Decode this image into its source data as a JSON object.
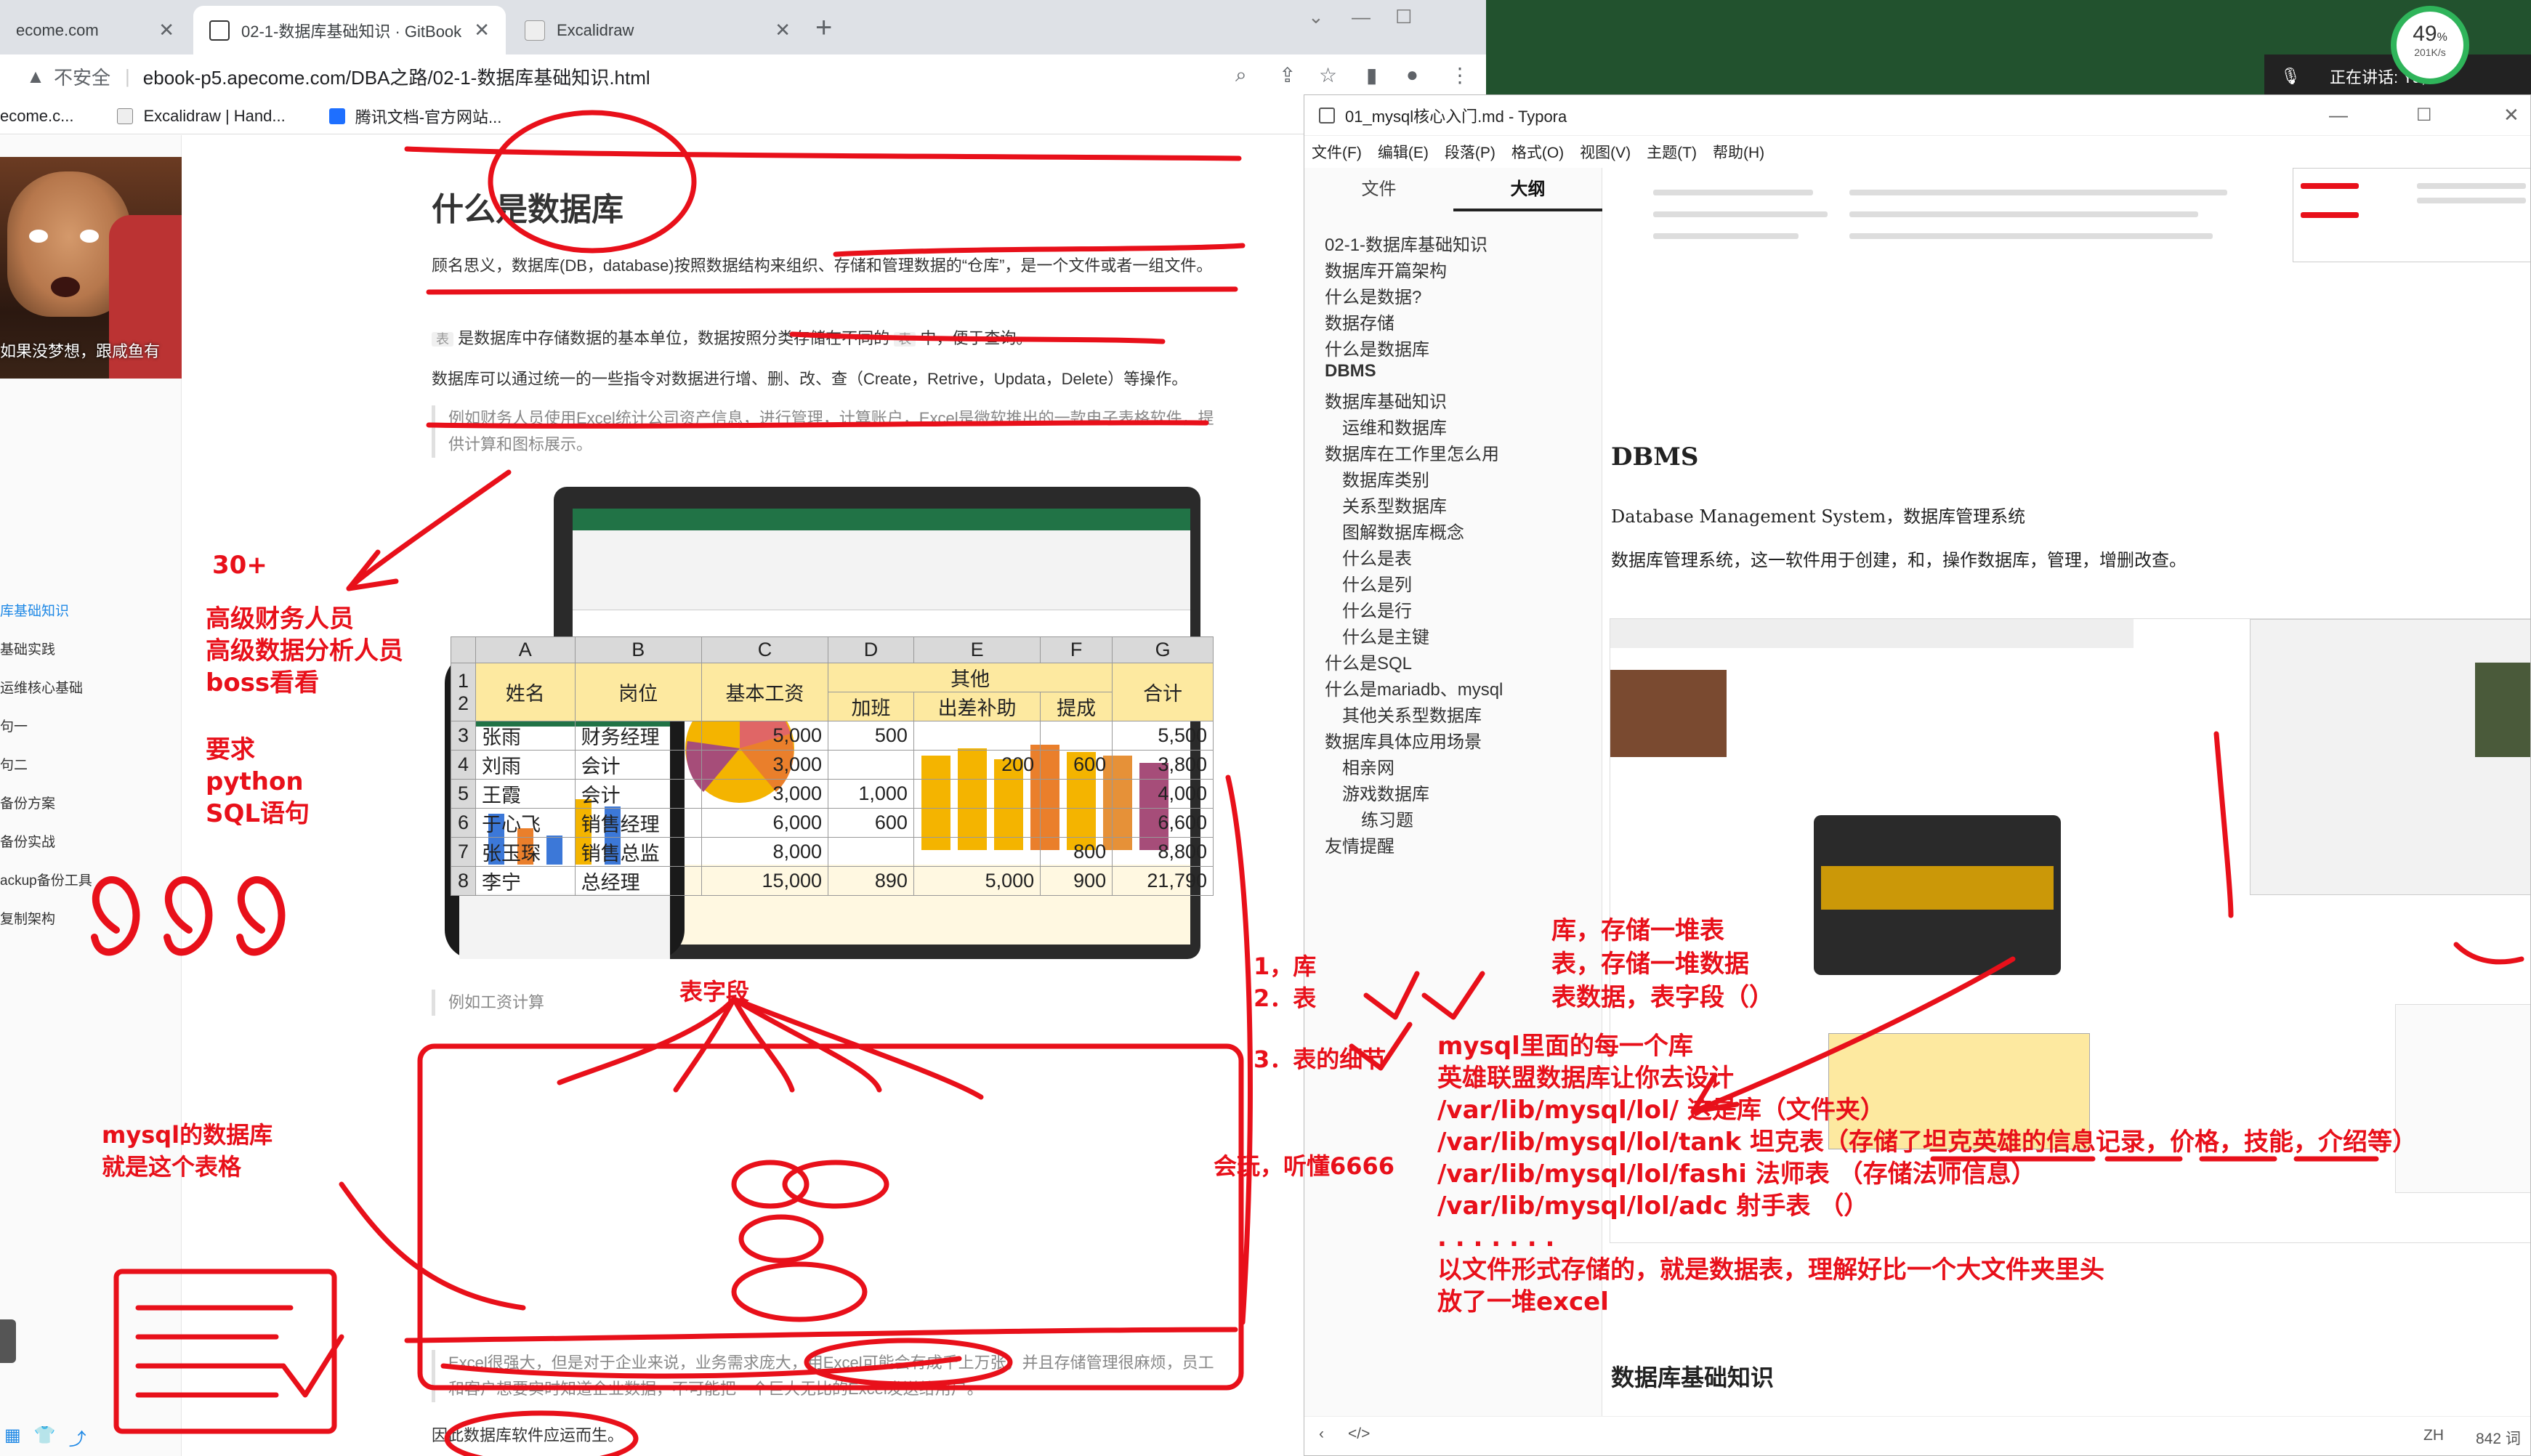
{
  "chrome": {
    "tabs": [
      {
        "label": "ecome.com"
      },
      {
        "label": "02-1-数据库基础知识 · GitBook"
      },
      {
        "label": "Excalidraw"
      }
    ],
    "new_tab": "+",
    "address": {
      "insecure": "不安全",
      "url": "ebook-p5.apecome.com/DBA之路/02-1-数据库基础知识.html"
    },
    "bookmarks": [
      "ecome.c...",
      "Excalidraw | Hand...",
      "腾讯文档-官方网站..."
    ]
  },
  "meeting": {
    "label": "正在讲话: Yu;"
  },
  "perf": {
    "percent": "49",
    "unit": "%",
    "speed": "201K/s"
  },
  "leftnav": {
    "video_caption": "如果没梦想，跟咸鱼有",
    "items": [
      "库基础知识",
      "基础实践",
      "运维核心基础",
      "句一",
      "句二",
      "备份方案",
      "备份实战",
      "ackup备份工具",
      "复制架构"
    ]
  },
  "article": {
    "title": "什么是数据库",
    "p1": "顾名思义，数据库(DB，database)按照数据结构来组织、存储和管理数据的“仓库”，是一个文件或者一组文件。",
    "p2_code": "表",
    "p2": "是数据库中存储数据的基本单位，数据按照分类存储在不同的",
    "p2_code2": "表",
    "p2_end": "中，便于查询。",
    "p3": "数据库可以通过统一的一些指令对数据进行增、删、改、查（Create，Retrive，Updata，Delete）等操作。",
    "q1": "例如财务人员使用Excel统计公司资产信息，进行管理，计算账户，Excel是微软推出的一款电子表格软件，提供计算和图标展示。",
    "q2": "例如工资计算",
    "q3": "Excel很强大，但是对于企业来说，业务需求庞大，用Excel可能会有成千上万张，并且存储管理很麻烦，员工和客户想要实时知道企业数据，不可能把一个巨大无比的Excel发送给用户。",
    "p4": "因此数据库软件应运而生。"
  },
  "spreadsheet": {
    "cols": [
      "A",
      "B",
      "C",
      "D",
      "E",
      "F",
      "G"
    ],
    "header1": [
      "姓名",
      "岗位",
      "基本工资",
      "其他",
      "合计"
    ],
    "header2": [
      "加班",
      "出差补助",
      "提成"
    ],
    "rows": [
      {
        "n": "3",
        "name": "张雨",
        "job": "财务经理",
        "base": "5,000",
        "ot": "500",
        "trip": "",
        "comm": "",
        "total": "5,500"
      },
      {
        "n": "4",
        "name": "刘雨",
        "job": "会计",
        "base": "3,000",
        "ot": "",
        "trip": "200",
        "comm": "600",
        "total": "3,800"
      },
      {
        "n": "5",
        "name": "王霞",
        "job": "会计",
        "base": "3,000",
        "ot": "1,000",
        "trip": "",
        "comm": "",
        "total": "4,000"
      },
      {
        "n": "6",
        "name": "于心飞",
        "job": "销售经理",
        "base": "6,000",
        "ot": "600",
        "trip": "",
        "comm": "",
        "total": "6,600"
      },
      {
        "n": "7",
        "name": "张玉琛",
        "job": "销售总监",
        "base": "8,000",
        "ot": "",
        "trip": "",
        "comm": "800",
        "total": "8,800"
      },
      {
        "n": "8",
        "name": "李宁",
        "job": "总经理",
        "base": "15,000",
        "ot": "890",
        "trip": "5,000",
        "comm": "900",
        "total": "21,790"
      }
    ]
  },
  "typora": {
    "title": "01_mysql核心入门.md - Typora",
    "menu": [
      "文件(F)",
      "编辑(E)",
      "段落(P)",
      "格式(O)",
      "视图(V)",
      "主题(T)",
      "帮助(H)"
    ],
    "side_tabs": [
      "文件",
      "大纲"
    ],
    "outline": [
      {
        "t": "02-1-数据库基础知识",
        "lvl": 0
      },
      {
        "t": "数据库开篇架构",
        "lvl": 0
      },
      {
        "t": "什么是数据?",
        "lvl": 0
      },
      {
        "t": "数据存储",
        "lvl": 0
      },
      {
        "t": "什么是数据库",
        "lvl": 0
      },
      {
        "t": "DBMS",
        "lvl": 0
      },
      {
        "t": "数据库基础知识",
        "lvl": 0
      },
      {
        "t": "运维和数据库",
        "lvl": 1
      },
      {
        "t": "数据库在工作里怎么用",
        "lvl": 0
      },
      {
        "t": "数据库类别",
        "lvl": 1
      },
      {
        "t": "关系型数据库",
        "lvl": 1
      },
      {
        "t": "图解数据库概念",
        "lvl": 1
      },
      {
        "t": "什么是表",
        "lvl": 1
      },
      {
        "t": "什么是列",
        "lvl": 1
      },
      {
        "t": "什么是行",
        "lvl": 1
      },
      {
        "t": "什么是主键",
        "lvl": 1
      },
      {
        "t": "什么是SQL",
        "lvl": 0
      },
      {
        "t": "什么是mariadb、mysql",
        "lvl": 0
      },
      {
        "t": "其他关系型数据库",
        "lvl": 1
      },
      {
        "t": "数据库具体应用场景",
        "lvl": 0
      },
      {
        "t": "相亲网",
        "lvl": 1
      },
      {
        "t": "游戏数据库",
        "lvl": 1
      },
      {
        "t": "练习题",
        "lvl": 2
      },
      {
        "t": "友情提醒",
        "lvl": 0
      }
    ],
    "h_dbms": "DBMS",
    "p_dbms1": "Database Management System，数据库管理系统",
    "p_dbms2": "数据库管理系统，这一软件用于创建，和，操作数据库，管理，增删改查。",
    "h_basic": "数据库基础知识",
    "status_lang": "ZH",
    "status_words": "842 词"
  },
  "annotations": {
    "n30": "30+",
    "finance": [
      "高级财务人员",
      "高级数据分析人员",
      "boss看看"
    ],
    "require": [
      "要求",
      "python",
      "SQL语句"
    ],
    "n666": "666",
    "mysql_db": [
      "mysql的数据库",
      "就是这个表格"
    ],
    "field": "表字段",
    "lib": [
      "1，库",
      "2．表",
      "3．表的细节"
    ],
    "play": "会玩，听懂6666",
    "store": [
      "库，存储一堆表",
      "表，存储一堆数据",
      "表数据，表字段（）"
    ],
    "mysql_lines": [
      "mysql里面的每一个库",
      "英雄联盟数据库让你去设计",
      "/var/lib/mysql/lol/      这是库（文件夹）",
      "/var/lib/mysql/lol/tank  坦克表（存储了坦克英雄的信息记录，价格，技能，介绍等）",
      "/var/lib/mysql/lol/fashi   法师表  （存储法师信息）",
      "/var/lib/mysql/lol/adc    射手表  （）",
      ".  .  .  .  .  .  .",
      "以文件形式存储的，就是数据表，理解好比一个大文件夹里头",
      "放了一堆excel"
    ]
  },
  "colors": {
    "ink": "#e8101a",
    "excel_green": "#217346",
    "chrome_bg": "#dee1e6"
  }
}
